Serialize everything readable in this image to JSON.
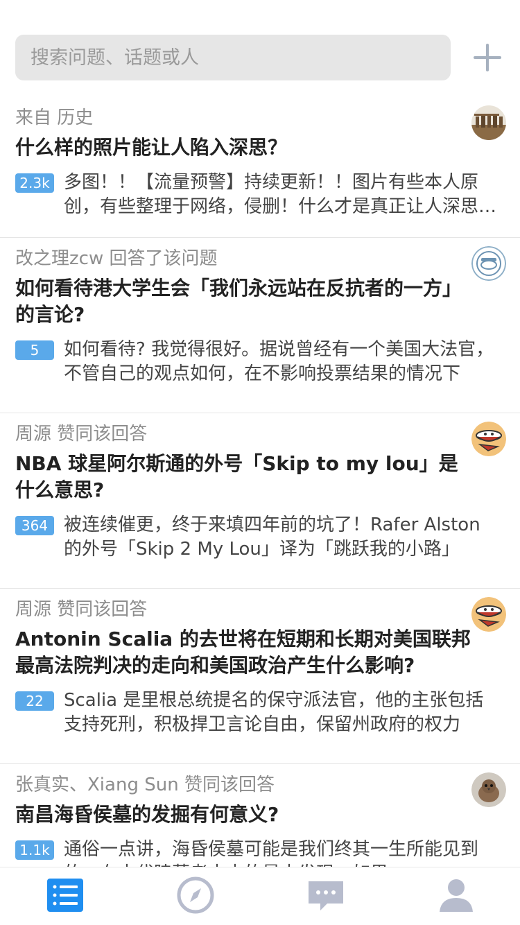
{
  "search": {
    "placeholder": "搜索问题、话题或人"
  },
  "colors": {
    "accent": "#1f8ef0",
    "badge": "#5aa9ea",
    "inactive_icon": "#b7bccd",
    "add_icon": "#a6b1bf"
  },
  "feed": [
    {
      "source": "来自 历史",
      "title": "什么样的照片能让人陷入深思？",
      "badge": "2.3k",
      "excerpt": "多图！！【流量预警】持续更新！！图片有些本人原创，有些整理于网络，侵删！什么才是真正让人深思的照片？",
      "avatar": "ruins-avatar"
    },
    {
      "source": "改之理zcw 回答了该问题",
      "title": "如何看待港大学生会「我们永远站在反抗者的一方」的言论?",
      "badge": "5",
      "excerpt": "如何看待? 我觉得很好。据说曾经有一个美国大法官，不管自己的观点如何，在不影响投票结果的情况下",
      "avatar": "badge-logo-avatar"
    },
    {
      "source": "周源 赞同该回答",
      "title": "NBA 球星阿尔斯通的外号「Skip to my lou」是什么意思?",
      "badge": "364",
      "excerpt": "被连续催更，终于来填四年前的坑了！Rafer Alston 的外号「Skip 2 My Lou」译为「跳跃我的小路」",
      "avatar": "cartoon-avatar"
    },
    {
      "source": "周源 赞同该回答",
      "title": "Antonin Scalia 的去世将在短期和长期对美国联邦最高法院判决的走向和美国政治产生什么影响?",
      "badge": "22",
      "excerpt": "Scalia 是里根总统提名的保守派法官，他的主张包括支持死刑，积极捍卫言论自由，保留州政府的权力",
      "avatar": "cartoon-avatar"
    },
    {
      "source": "张真实、Xiang Sun 赞同该回答",
      "title": "南昌海昏侯墓的发掘有何意义?",
      "badge": "1.1k",
      "excerpt": "通俗一点讲，海昏侯墓可能是我们终其一生所能见到的，在古代陵墓考古中的最大发现。如果",
      "avatar": "bird-avatar"
    }
  ],
  "tabbar": {
    "items": [
      "feed-icon",
      "compass-icon",
      "message-icon",
      "profile-icon"
    ],
    "active": "feed-icon"
  }
}
